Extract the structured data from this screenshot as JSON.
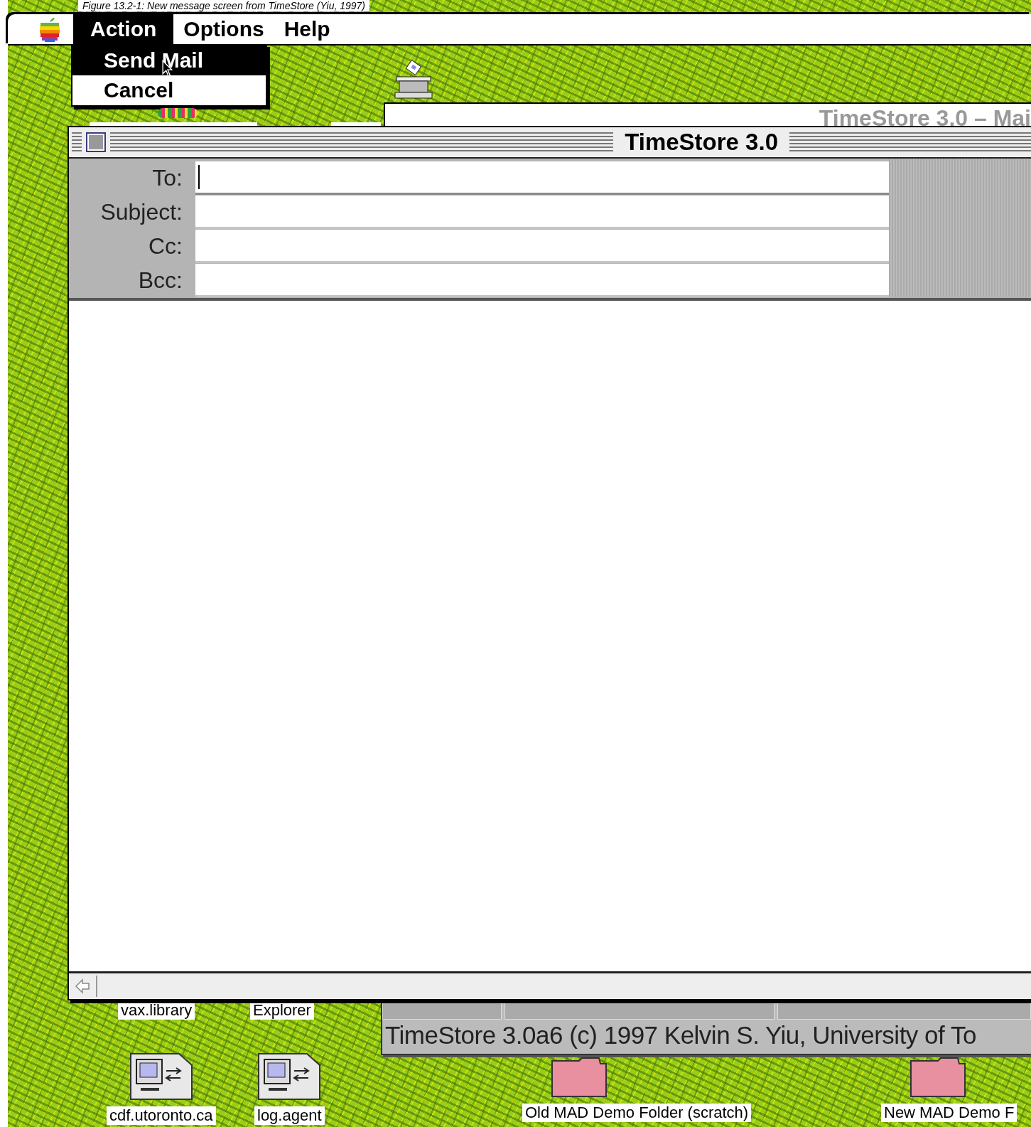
{
  "caption": "Figure 13.2-1: New message screen from TimeStore (Yiu, 1997)",
  "menu_bar": {
    "items": [
      {
        "label": "Action",
        "selected": true
      },
      {
        "label": "Options",
        "selected": false
      },
      {
        "label": "Help",
        "selected": false
      }
    ]
  },
  "dropdown": {
    "items": [
      {
        "label": "Send Mail",
        "selected": true
      },
      {
        "label": "Cancel",
        "selected": false
      }
    ]
  },
  "background_window": {
    "title": "TimeStore 3.0 – Mai"
  },
  "window": {
    "title": "TimeStore 3.0",
    "fields": [
      {
        "label": "To:",
        "focused": true
      },
      {
        "label": "Subject:",
        "focused": false
      },
      {
        "label": "Cc:",
        "focused": false
      },
      {
        "label": "Bcc:",
        "focused": false
      }
    ]
  },
  "status_window": {
    "text": "TimeStore 3.0a6 (c) 1997 Kelvin S. Yiu, University of To"
  },
  "desktop_icons": [
    {
      "label": "vax.library",
      "kind": "label"
    },
    {
      "label": "Explorer",
      "kind": "label"
    },
    {
      "label": "cdf.utoronto.ca",
      "kind": "server"
    },
    {
      "label": "log.agent",
      "kind": "server"
    },
    {
      "label": "Old MAD Demo Folder (scratch)",
      "kind": "folder"
    },
    {
      "label": "New MAD Demo F",
      "kind": "folder"
    }
  ]
}
